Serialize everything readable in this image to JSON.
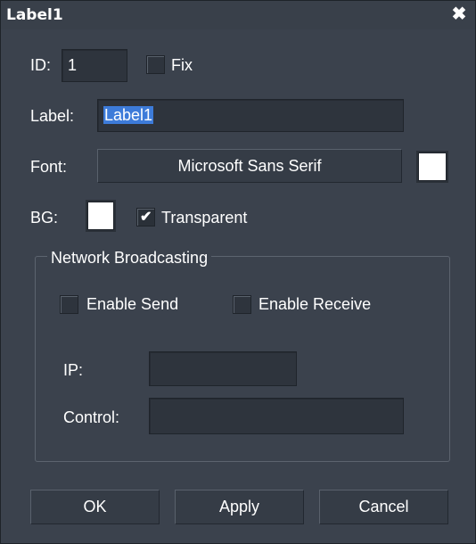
{
  "window": {
    "title": "Label1",
    "close_glyph": "✖"
  },
  "id_row": {
    "label": "ID:",
    "value": "1",
    "fix_label": "Fix",
    "fix_checked": false
  },
  "label_row": {
    "label": "Label:",
    "value": "Label1"
  },
  "font_row": {
    "label": "Font:",
    "font_name": "Microsoft Sans Serif",
    "color": "#ffffff"
  },
  "bg_row": {
    "label": "BG:",
    "color": "#ffffff",
    "transparent_label": "Transparent",
    "transparent_checked": true,
    "check_glyph": "✔"
  },
  "network": {
    "title": "Network Broadcasting",
    "enable_send_label": "Enable Send",
    "enable_send_checked": false,
    "enable_receive_label": "Enable Receive",
    "enable_receive_checked": false,
    "ip_label": "IP:",
    "ip_value": "",
    "control_label": "Control:",
    "control_value": ""
  },
  "buttons": {
    "ok": "OK",
    "apply": "Apply",
    "cancel": "Cancel"
  }
}
